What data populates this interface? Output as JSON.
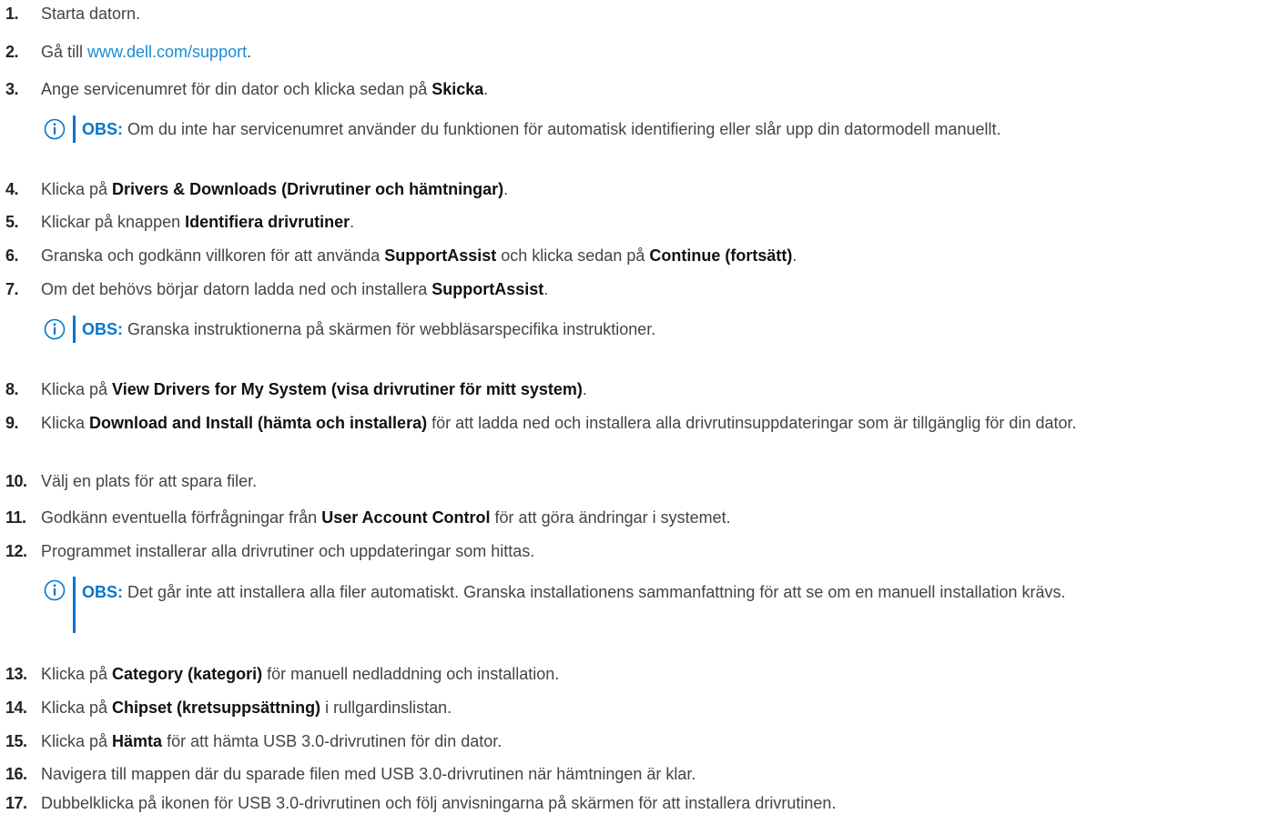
{
  "steps": [
    {
      "num": "1.",
      "parts": [
        "Starta datorn."
      ]
    },
    {
      "num": "2.",
      "parts": [
        "Gå till ",
        "www.dell.com/support",
        "."
      ]
    },
    {
      "num": "3.",
      "parts": [
        "Ange servicenumret för din dator och klicka sedan på ",
        "Skicka",
        "."
      ]
    },
    {
      "num": "4.",
      "parts": [
        "Klicka på ",
        "Drivers & Downloads (Drivrutiner och hämtningar)",
        "."
      ]
    },
    {
      "num": "5.",
      "parts": [
        "Klickar på knappen ",
        "Identifiera drivrutiner",
        "."
      ]
    },
    {
      "num": "6.",
      "parts": [
        "Granska och godkänn villkoren för att använda ",
        "SupportAssist",
        " och klicka sedan på ",
        "Continue (fortsätt)",
        "."
      ]
    },
    {
      "num": "7.",
      "parts": [
        "Om det behövs börjar datorn ladda ned och installera ",
        "SupportAssist",
        "."
      ]
    },
    {
      "num": "8.",
      "parts": [
        "Klicka på ",
        "View Drivers for My System (visa drivrutiner för mitt system)",
        "."
      ]
    },
    {
      "num": "9.",
      "parts": [
        "Klicka ",
        "Download and Install (hämta och installera)",
        " för att ladda ned och installera alla drivrutinsuppdateringar som är tillgänglig för din dator."
      ]
    },
    {
      "num": "10.",
      "parts": [
        "Välj en plats för att spara filer."
      ]
    },
    {
      "num": "11.",
      "parts": [
        "Godkänn eventuella förfrågningar från ",
        "User Account Control",
        " för att göra ändringar i systemet."
      ]
    },
    {
      "num": "12.",
      "parts": [
        "Programmet installerar alla drivrutiner och uppdateringar som hittas."
      ]
    },
    {
      "num": "13.",
      "parts": [
        "Klicka på ",
        "Category (kategori)",
        " för manuell nedladdning och installation."
      ]
    },
    {
      "num": "14.",
      "parts": [
        "Klicka på ",
        "Chipset (kretsuppsättning)",
        " i rullgardinslistan."
      ]
    },
    {
      "num": "15.",
      "parts": [
        "Klicka på ",
        "Hämta",
        " för att hämta USB 3.0-drivrutinen för din dator."
      ]
    },
    {
      "num": "16.",
      "parts": [
        "Navigera till mappen där du sparade filen med USB 3.0-drivrutinen när hämtningen är klar."
      ]
    },
    {
      "num": "17.",
      "parts": [
        "Dubbelklicka på ikonen för USB 3.0-drivrutinen och följ anvisningarna på skärmen för att installera drivrutinen."
      ]
    }
  ],
  "notes": [
    {
      "label": "OBS:",
      "text": " Om du inte har servicenumret använder du funktionen för automatisk identifiering eller slår upp din datormodell manuellt."
    },
    {
      "label": "OBS:",
      "text": " Granska instruktionerna på skärmen för webbläsarspecifika instruktioner."
    },
    {
      "label": "OBS:",
      "text": " Det går inte att installera alla filer automatiskt. Granska installationens sammanfattning för att se om en manuell installation krävs."
    }
  ],
  "colors": {
    "accent": "#0076ce",
    "link": "#1a8bd6",
    "text": "#444444"
  },
  "icons": {
    "note_icon": "info-circle-icon"
  }
}
